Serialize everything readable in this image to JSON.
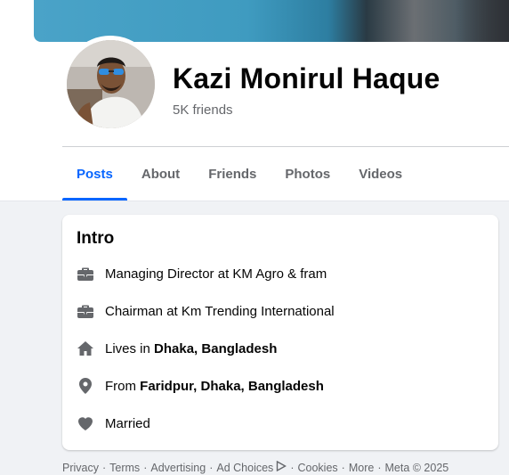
{
  "profile": {
    "name": "Kazi Monirul Haque",
    "friends": "5K friends"
  },
  "tabs": [
    {
      "label": "Posts",
      "active": true
    },
    {
      "label": "About",
      "active": false
    },
    {
      "label": "Friends",
      "active": false
    },
    {
      "label": "Photos",
      "active": false
    },
    {
      "label": "Videos",
      "active": false
    }
  ],
  "intro": {
    "title": "Intro",
    "items": [
      {
        "icon": "briefcase-icon",
        "text": "Managing Director at KM Agro & fram"
      },
      {
        "icon": "briefcase-icon",
        "text": "Chairman at Km Trending International"
      },
      {
        "icon": "home-icon",
        "prefix": "Lives in ",
        "bold": "Dhaka, Bangladesh"
      },
      {
        "icon": "location-pin-icon",
        "prefix": "From ",
        "bold": "Faridpur, Dhaka, Bangladesh"
      },
      {
        "icon": "heart-icon",
        "text": "Married"
      }
    ]
  },
  "footer": {
    "links": [
      "Privacy",
      "Terms",
      "Advertising",
      "Ad Choices",
      "Cookies",
      "More"
    ],
    "copyright": "Meta © 2025",
    "separator": "·"
  },
  "colors": {
    "accent": "#0866ff",
    "secondary_text": "#65676b",
    "icon": "#65676b",
    "background": "#f0f2f5"
  }
}
